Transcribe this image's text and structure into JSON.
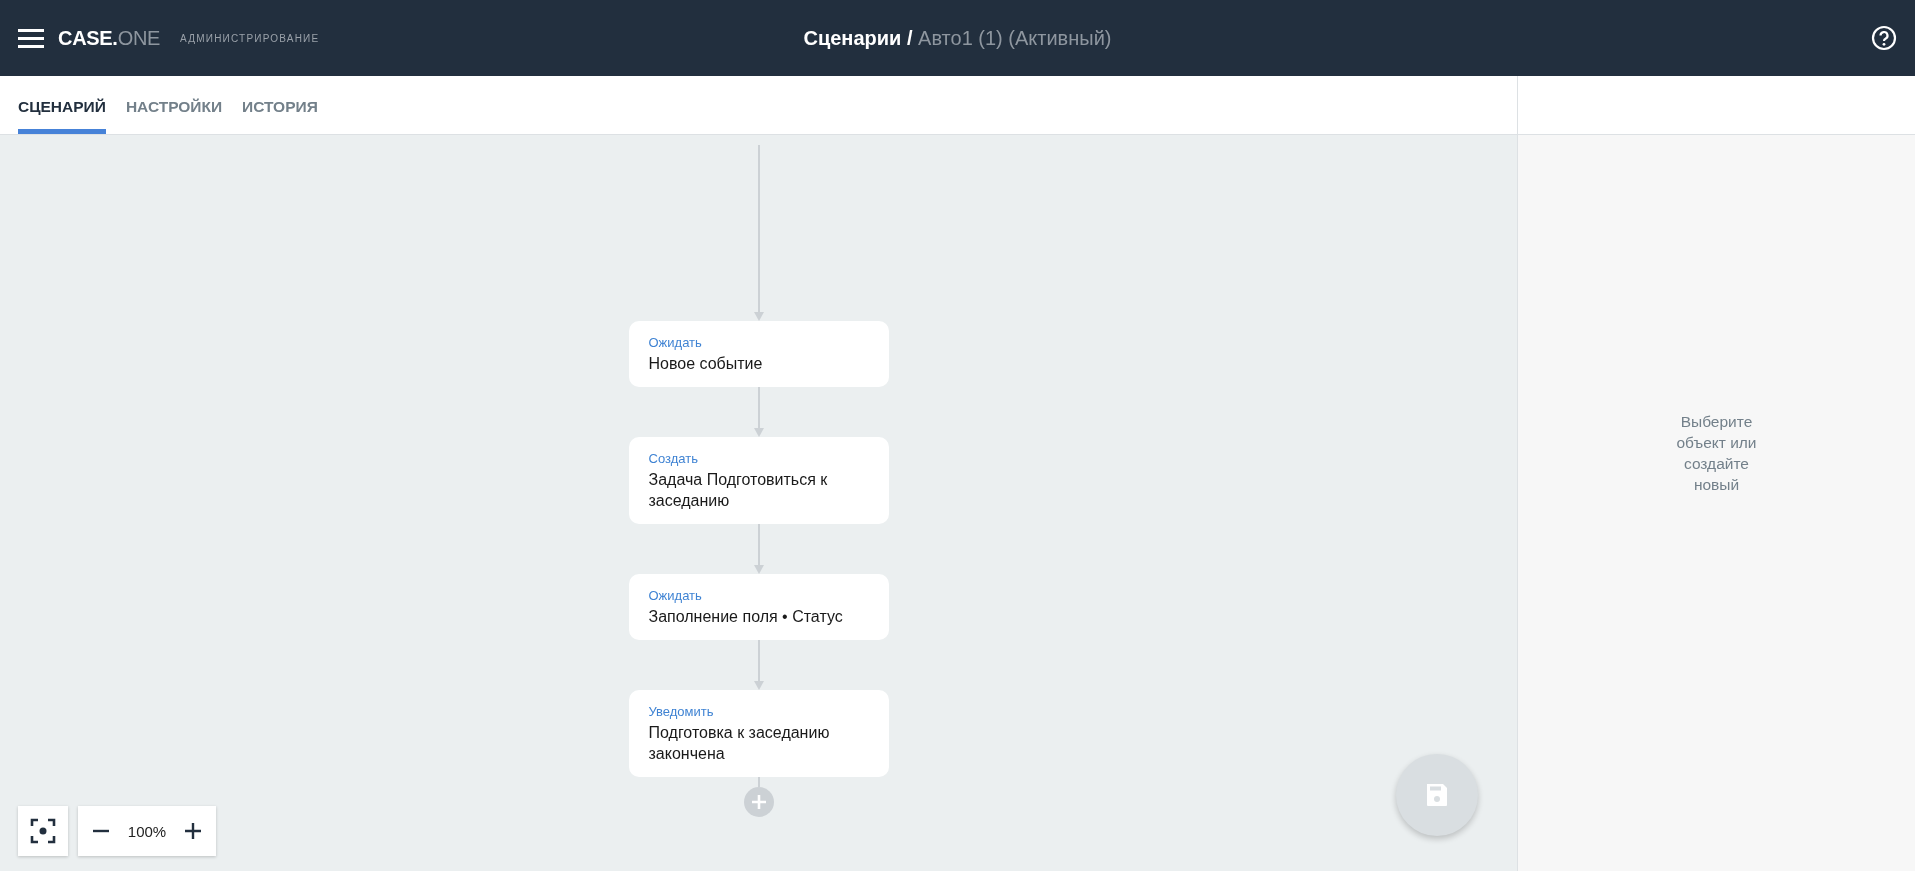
{
  "header": {
    "logo": {
      "primary": "CASE.",
      "secondary": "ONE"
    },
    "subtitle": "АДМИНИСТРИРОВАНИЕ",
    "title": {
      "section": "Сценарии /",
      "item": "Авто1 (1) (Активный)"
    }
  },
  "tabs": [
    {
      "label": "СЦЕНАРИЙ",
      "selected": true
    },
    {
      "label": "НАСТРОЙКИ",
      "selected": false
    },
    {
      "label": "ИСТОРИЯ",
      "selected": false
    }
  ],
  "nodes": [
    {
      "action": "Ожидать",
      "text": "Новое событие"
    },
    {
      "action": "Создать",
      "text": "Задача Подготовиться к заседанию"
    },
    {
      "action": "Ожидать",
      "text": "Заполнение поля • Статус"
    },
    {
      "action": "Уведомить",
      "text": "Подготовка к заседанию закончена"
    }
  ],
  "zoom": {
    "value": "100%"
  },
  "side_panel": {
    "hint": "Выберите объект или создайте новый"
  }
}
